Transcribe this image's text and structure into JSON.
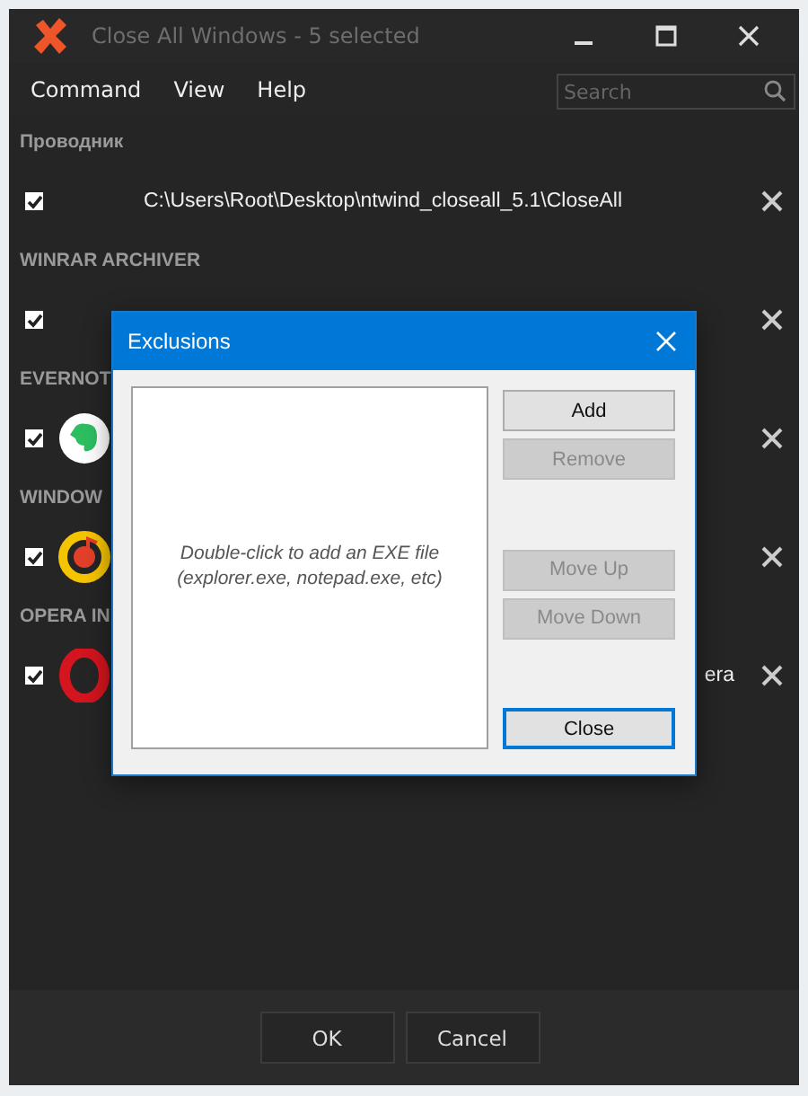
{
  "window": {
    "title": "Close All Windows - 5 selected"
  },
  "menu": [
    {
      "label": "Command"
    },
    {
      "label": "View"
    },
    {
      "label": "Help"
    }
  ],
  "search": {
    "placeholder": "Search"
  },
  "groups": [
    {
      "name": "Проводник",
      "items": [
        {
          "kind": "none",
          "text": "C:\\Users\\Root\\Desktop\\ntwind_closeall_5.1\\CloseAll",
          "checked": true
        }
      ]
    },
    {
      "name": "WINRAR ARCHIVER",
      "items": [
        {
          "kind": "none",
          "checked": true
        }
      ]
    },
    {
      "name": "EVERNOT",
      "items": [
        {
          "kind": "elephant",
          "checked": true
        }
      ]
    },
    {
      "name": "WINDOW",
      "items": [
        {
          "kind": "music",
          "checked": true
        }
      ]
    },
    {
      "name": "OPERA IN",
      "items": [
        {
          "kind": "ring",
          "tail": "era",
          "checked": true
        }
      ]
    }
  ],
  "footer": {
    "buttons": [
      {
        "label": "OK"
      },
      {
        "label": "Cancel"
      }
    ]
  },
  "dialog": {
    "title": "Exclusions",
    "hint_lines": [
      "Double-click to add an EXE file",
      "(explorer.exe, notepad.exe, etc)"
    ],
    "button_groups": [
      [
        {
          "label": "Add",
          "disabled": false,
          "focused": false
        },
        {
          "label": "Remove",
          "disabled": true,
          "focused": false
        }
      ],
      [
        {
          "label": "Move Up",
          "disabled": true,
          "focused": false
        },
        {
          "label": "Move Down",
          "disabled": true,
          "focused": false
        }
      ],
      [
        {
          "label": "Close",
          "disabled": false,
          "focused": true
        }
      ]
    ]
  }
}
